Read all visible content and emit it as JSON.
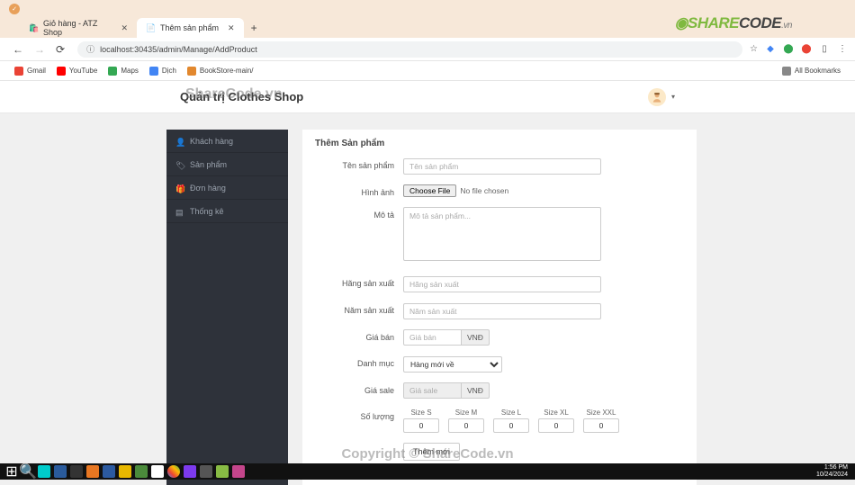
{
  "browser": {
    "tabs": [
      {
        "title": "Giỏ hàng - ATZ Shop",
        "active": false
      },
      {
        "title": "Thêm sản phẩm",
        "active": true
      }
    ],
    "url": "localhost:30435/admin/Manage/AddProduct",
    "bookmarks": [
      {
        "label": "Gmail",
        "color": "#ea4335"
      },
      {
        "label": "YouTube",
        "color": "#ff0000"
      },
      {
        "label": "Maps",
        "color": "#34a853"
      },
      {
        "label": "Dịch",
        "color": "#4285f4"
      },
      {
        "label": "BookStore-main/",
        "color": "#e2882e"
      }
    ],
    "all_bookmarks": "All Bookmarks"
  },
  "header": {
    "title": "Quản trị Clothes Shop"
  },
  "sidebar": {
    "items": [
      {
        "label": "Khách hàng",
        "icon": "user-icon"
      },
      {
        "label": "Sản phẩm",
        "icon": "tag-icon"
      },
      {
        "label": "Đơn hàng",
        "icon": "gift-icon"
      },
      {
        "label": "Thống kê",
        "icon": "chart-icon"
      }
    ]
  },
  "form": {
    "heading": "Thêm Sản phẩm",
    "labels": {
      "name": "Tên sản phẩm",
      "image": "Hình ảnh",
      "desc": "Mô tả",
      "manufacturer": "Hãng sản xuất",
      "year": "Năm sản xuất",
      "price": "Giá bán",
      "category": "Danh mục",
      "sale": "Giá sale",
      "qty": "Số lượng"
    },
    "placeholders": {
      "name": "Tên sản phẩm",
      "desc": "Mô tả sản phẩm...",
      "manufacturer": "Hãng sản xuất",
      "year": "Năm sản xuất",
      "price": "Giá bán",
      "sale": "Giá sale"
    },
    "file_button": "Choose File",
    "file_status": "No file chosen",
    "currency": "VNĐ",
    "category_selected": "Hàng mới về",
    "sizes": [
      {
        "label": "Size S",
        "value": "0"
      },
      {
        "label": "Size M",
        "value": "0"
      },
      {
        "label": "Size L",
        "value": "0"
      },
      {
        "label": "Size XL",
        "value": "0"
      },
      {
        "label": "Size XXL",
        "value": "0"
      }
    ],
    "submit": "Thêm mới"
  },
  "watermarks": {
    "logo_share": "SHARE",
    "logo_code": "CODE",
    "logo_vn": ".vn",
    "mid": "ShareCode.vn",
    "bottom": "Copyright © ShareCode.vn"
  },
  "taskbar": {
    "time": "1:56 PM",
    "date": "10/24/2024"
  }
}
